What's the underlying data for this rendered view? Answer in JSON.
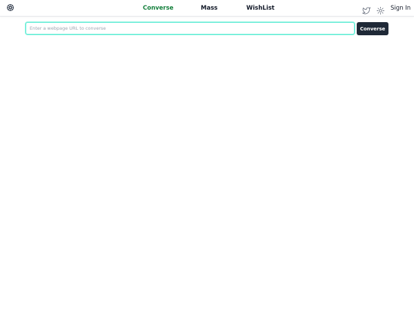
{
  "nav": {
    "items": [
      {
        "label": "Converse",
        "active": true
      },
      {
        "label": "Mass",
        "active": false
      },
      {
        "label": "WishList",
        "active": false
      }
    ],
    "active_color": "#15803d",
    "sign_in_label": "Sign In",
    "icons": {
      "logo": "chatgpt-logo-icon",
      "twitter": "twitter-icon",
      "theme": "sun-icon"
    }
  },
  "converse": {
    "input_placeholder": "Enter a webpage URL to converse",
    "input_value": "",
    "submit_label": "Converse",
    "input_border_color": "#5eead4",
    "button_color": "#1f2937"
  }
}
